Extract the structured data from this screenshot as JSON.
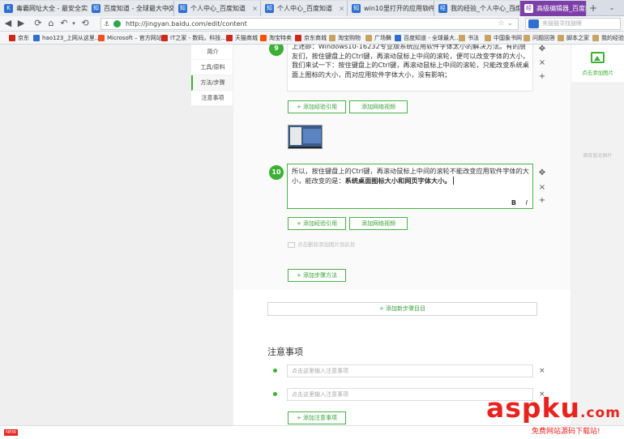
{
  "tabs": [
    {
      "label": "毒霸网址大全 - 最安全实..."
    },
    {
      "label": "百度知道 - 全球最大中文..."
    },
    {
      "label": "个人中心_百度知道"
    },
    {
      "label": "个人中心_百度知道"
    },
    {
      "label": "win10里打开的应用软件..."
    },
    {
      "label": "我的经验_个人中心_百度..."
    },
    {
      "label": "高级编辑器_百度经验"
    }
  ],
  "address": {
    "url": "http://jingyan.baidu.com/edit/content",
    "search_placeholder": "夹鼓鼓寻找鼓眼"
  },
  "bookmarks": [
    {
      "label": "京东",
      "color": "#d0261c"
    },
    {
      "label": "hao123_上网从这里...",
      "color": "#2f6fd0"
    },
    {
      "label": "Microsoft – 官方网站",
      "color": "#f25022"
    },
    {
      "label": "IT之家 - 数码，科技...",
      "color": "#d0261c"
    },
    {
      "label": "天猫商城",
      "color": "#d0261c"
    },
    {
      "label": "淘宝特卖",
      "color": "#ff5000"
    },
    {
      "label": "京东商城",
      "color": "#d0261c"
    },
    {
      "label": "淘宝购物",
      "color": "#c8a464"
    },
    {
      "label": "广场舞",
      "color": "#c8a464"
    },
    {
      "label": "百度知道 - 全球最大...",
      "color": "#2f6fd0"
    },
    {
      "label": "书法",
      "color": "#c8a464"
    },
    {
      "label": "中国象书网",
      "color": "#c8a464"
    },
    {
      "label": "问题回答",
      "color": "#c8a464"
    },
    {
      "label": "脚本之家",
      "color": "#c8a464"
    },
    {
      "label": "我的经验",
      "color": "#c8a464"
    }
  ],
  "sidenav": {
    "items": [
      {
        "label": "简介"
      },
      {
        "label": "工具/原料"
      },
      {
        "label": "方法/步骤"
      },
      {
        "label": "注意事项"
      }
    ]
  },
  "steps": [
    {
      "number": "9",
      "text": "上述即：Windows10-16232专业版系统应用软件字体太小的解决方法。有的朋友们，按住键盘上的Ctrl键，再滚动鼠标上中间的滚轮，便可以改变字体的大小，我们来试一下：按住键盘上的Ctrl键，再滚动鼠标上中间的滚轮，只能改变系统桌面上图标的大小，而对应用软件字体大小，没有影响；"
    },
    {
      "number": "10",
      "text_plain": "所以，按住键盘上的Ctrl键，再滚动鼠标上中间的滚轮不能改变应用软件字体的大小，能改变的是：",
      "text_bold": "系统桌面图标大小和网页字体大小。"
    }
  ],
  "buttons": {
    "add_reference": "+ 添加经验引用",
    "add_video": "添加网络视频",
    "add_method": "+ 添加步骤方法",
    "add_section": "+ 添加新步骤目目",
    "add_note": "+ 添加注意事项"
  },
  "upload_hint": "点击删除添加图片到此处",
  "format": {
    "bold": "B",
    "italic": "I"
  },
  "notes": {
    "title": "注意事项",
    "placeholder": "点击这里输入注意事项"
  },
  "right_panel": {
    "add_image": "点击添加图片",
    "empty_text": "图库暂无图片"
  },
  "watermark": {
    "brand": "aspku",
    "tld": ".com",
    "tagline": "免费网站源码下载站!"
  },
  "status": {
    "new_badge": "NEW"
  },
  "colors": {
    "accent": "#3cb035",
    "active_tab": "#7c3fa8",
    "watermark": "#e8231f"
  }
}
